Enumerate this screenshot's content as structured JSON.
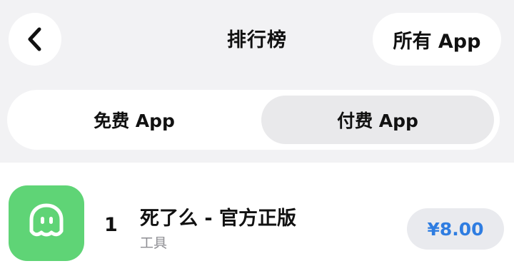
{
  "nav": {
    "back_icon": "chevron-left-icon",
    "title": "排行榜",
    "all_apps_label": "所有 App"
  },
  "segments": {
    "free_label": "免费 App",
    "paid_label": "付费 App",
    "selected": "付费 App"
  },
  "apps": [
    {
      "rank": "1",
      "name": "死了么 - 官方正版",
      "category": "工具",
      "price": "¥8.00",
      "icon": "ghost-icon",
      "icon_color": "#5fd476"
    }
  ],
  "colors": {
    "price_text": "#2f7de1",
    "header_background": "#f2f2f4"
  }
}
